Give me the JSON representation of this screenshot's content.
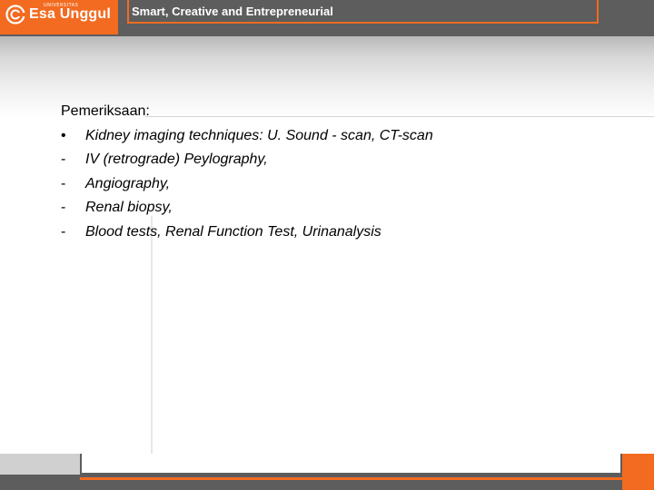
{
  "header": {
    "logo_small_text": "UNIVERSITAS",
    "logo_name": "Esa Unggul",
    "tagline": "Smart, Creative and Entrepreneurial"
  },
  "content": {
    "heading": "Pemeriksaan:",
    "items": [
      {
        "marker": "•",
        "text": "Kidney imaging techniques: U. Sound - scan, CT-scan"
      },
      {
        "marker": "-",
        "text": "IV (retrograde) Peylography,"
      },
      {
        "marker": "-",
        "text": "Angiography,"
      },
      {
        "marker": "-",
        "text": "Renal biopsy,"
      },
      {
        "marker": "-",
        "text": "Blood tests, Renal Function Test, Urinanalysis"
      }
    ]
  },
  "colors": {
    "brand_orange": "#f26b21",
    "header_gray": "#5d5d5d"
  },
  "icons": {
    "logo": "esa-unggul-logo-icon"
  }
}
